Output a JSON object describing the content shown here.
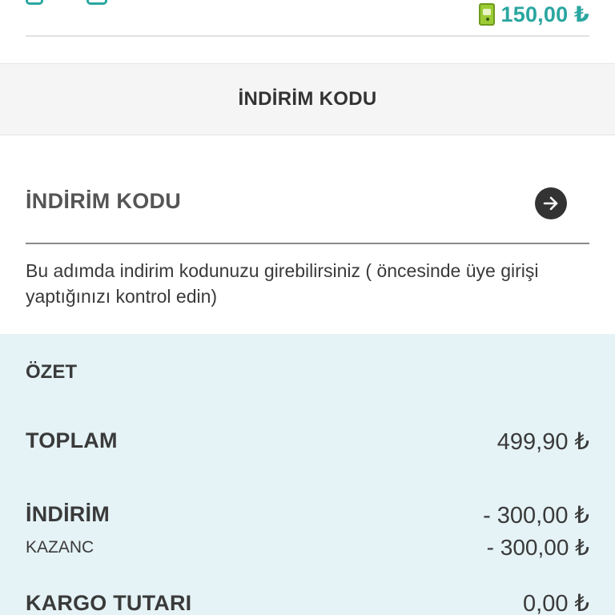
{
  "product_row": {
    "price": "150,00 ₺",
    "price_color": "#2aa6a0",
    "gift_icon": "gift-card-icon"
  },
  "section_header": {
    "title": "İNDİRİM KODU"
  },
  "discount_code": {
    "placeholder": "İNDİRİM KODU",
    "value": "",
    "submit_icon": "arrow-right-circle-icon",
    "help_text": "Bu adımda indirim kodunuzu girebilirsiniz ( öncesinde üye girişi yaptığınızı kontrol edin)"
  },
  "summary": {
    "title": "ÖZET",
    "background_color": "#e5f3f6",
    "rows": {
      "total": {
        "label": "TOPLAM",
        "value": "499,90 ₺"
      },
      "discount": {
        "label": "İNDİRİM",
        "value": "- 300,00 ₺"
      },
      "gain": {
        "label": "KAZANC",
        "value": "- 300,00 ₺"
      },
      "shipping": {
        "label": "KARGO TUTARI",
        "value": "0,00 ₺"
      }
    }
  }
}
